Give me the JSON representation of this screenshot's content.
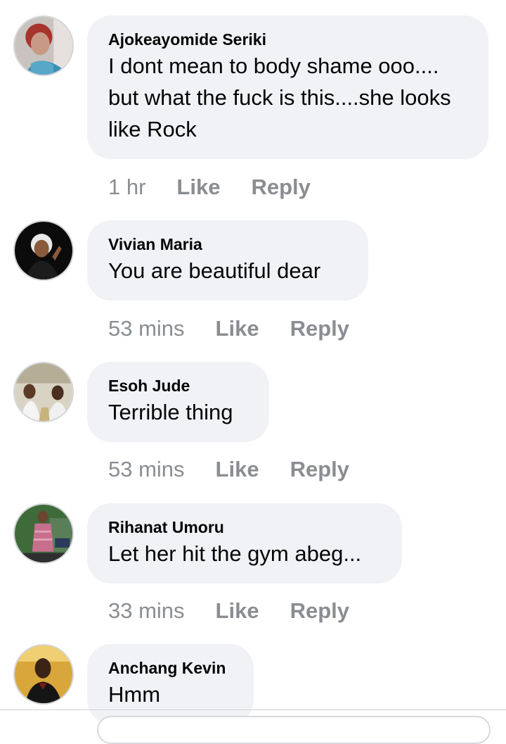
{
  "comments": [
    {
      "author": "Ajokeayomide Seriki",
      "text": "I dont mean to body shame ooo.... but what the fuck is this....she looks like Rock",
      "time": "1 hr",
      "like_label": "Like",
      "reply_label": "Reply"
    },
    {
      "author": "Vivian Maria",
      "text": "You are beautiful dear",
      "time": "53 mins",
      "like_label": "Like",
      "reply_label": "Reply"
    },
    {
      "author": "Esoh Jude",
      "text": "Terrible thing",
      "time": "53 mins",
      "like_label": "Like",
      "reply_label": "Reply"
    },
    {
      "author": "Rihanat Umoru",
      "text": "Let her hit the gym abeg...",
      "time": "33 mins",
      "like_label": "Like",
      "reply_label": "Reply"
    },
    {
      "author": "Anchang Kevin",
      "text": "Hmm"
    }
  ],
  "colors": {
    "bubble": "#f0f2f5",
    "text": "#050505",
    "meta": "#8a8d91"
  }
}
